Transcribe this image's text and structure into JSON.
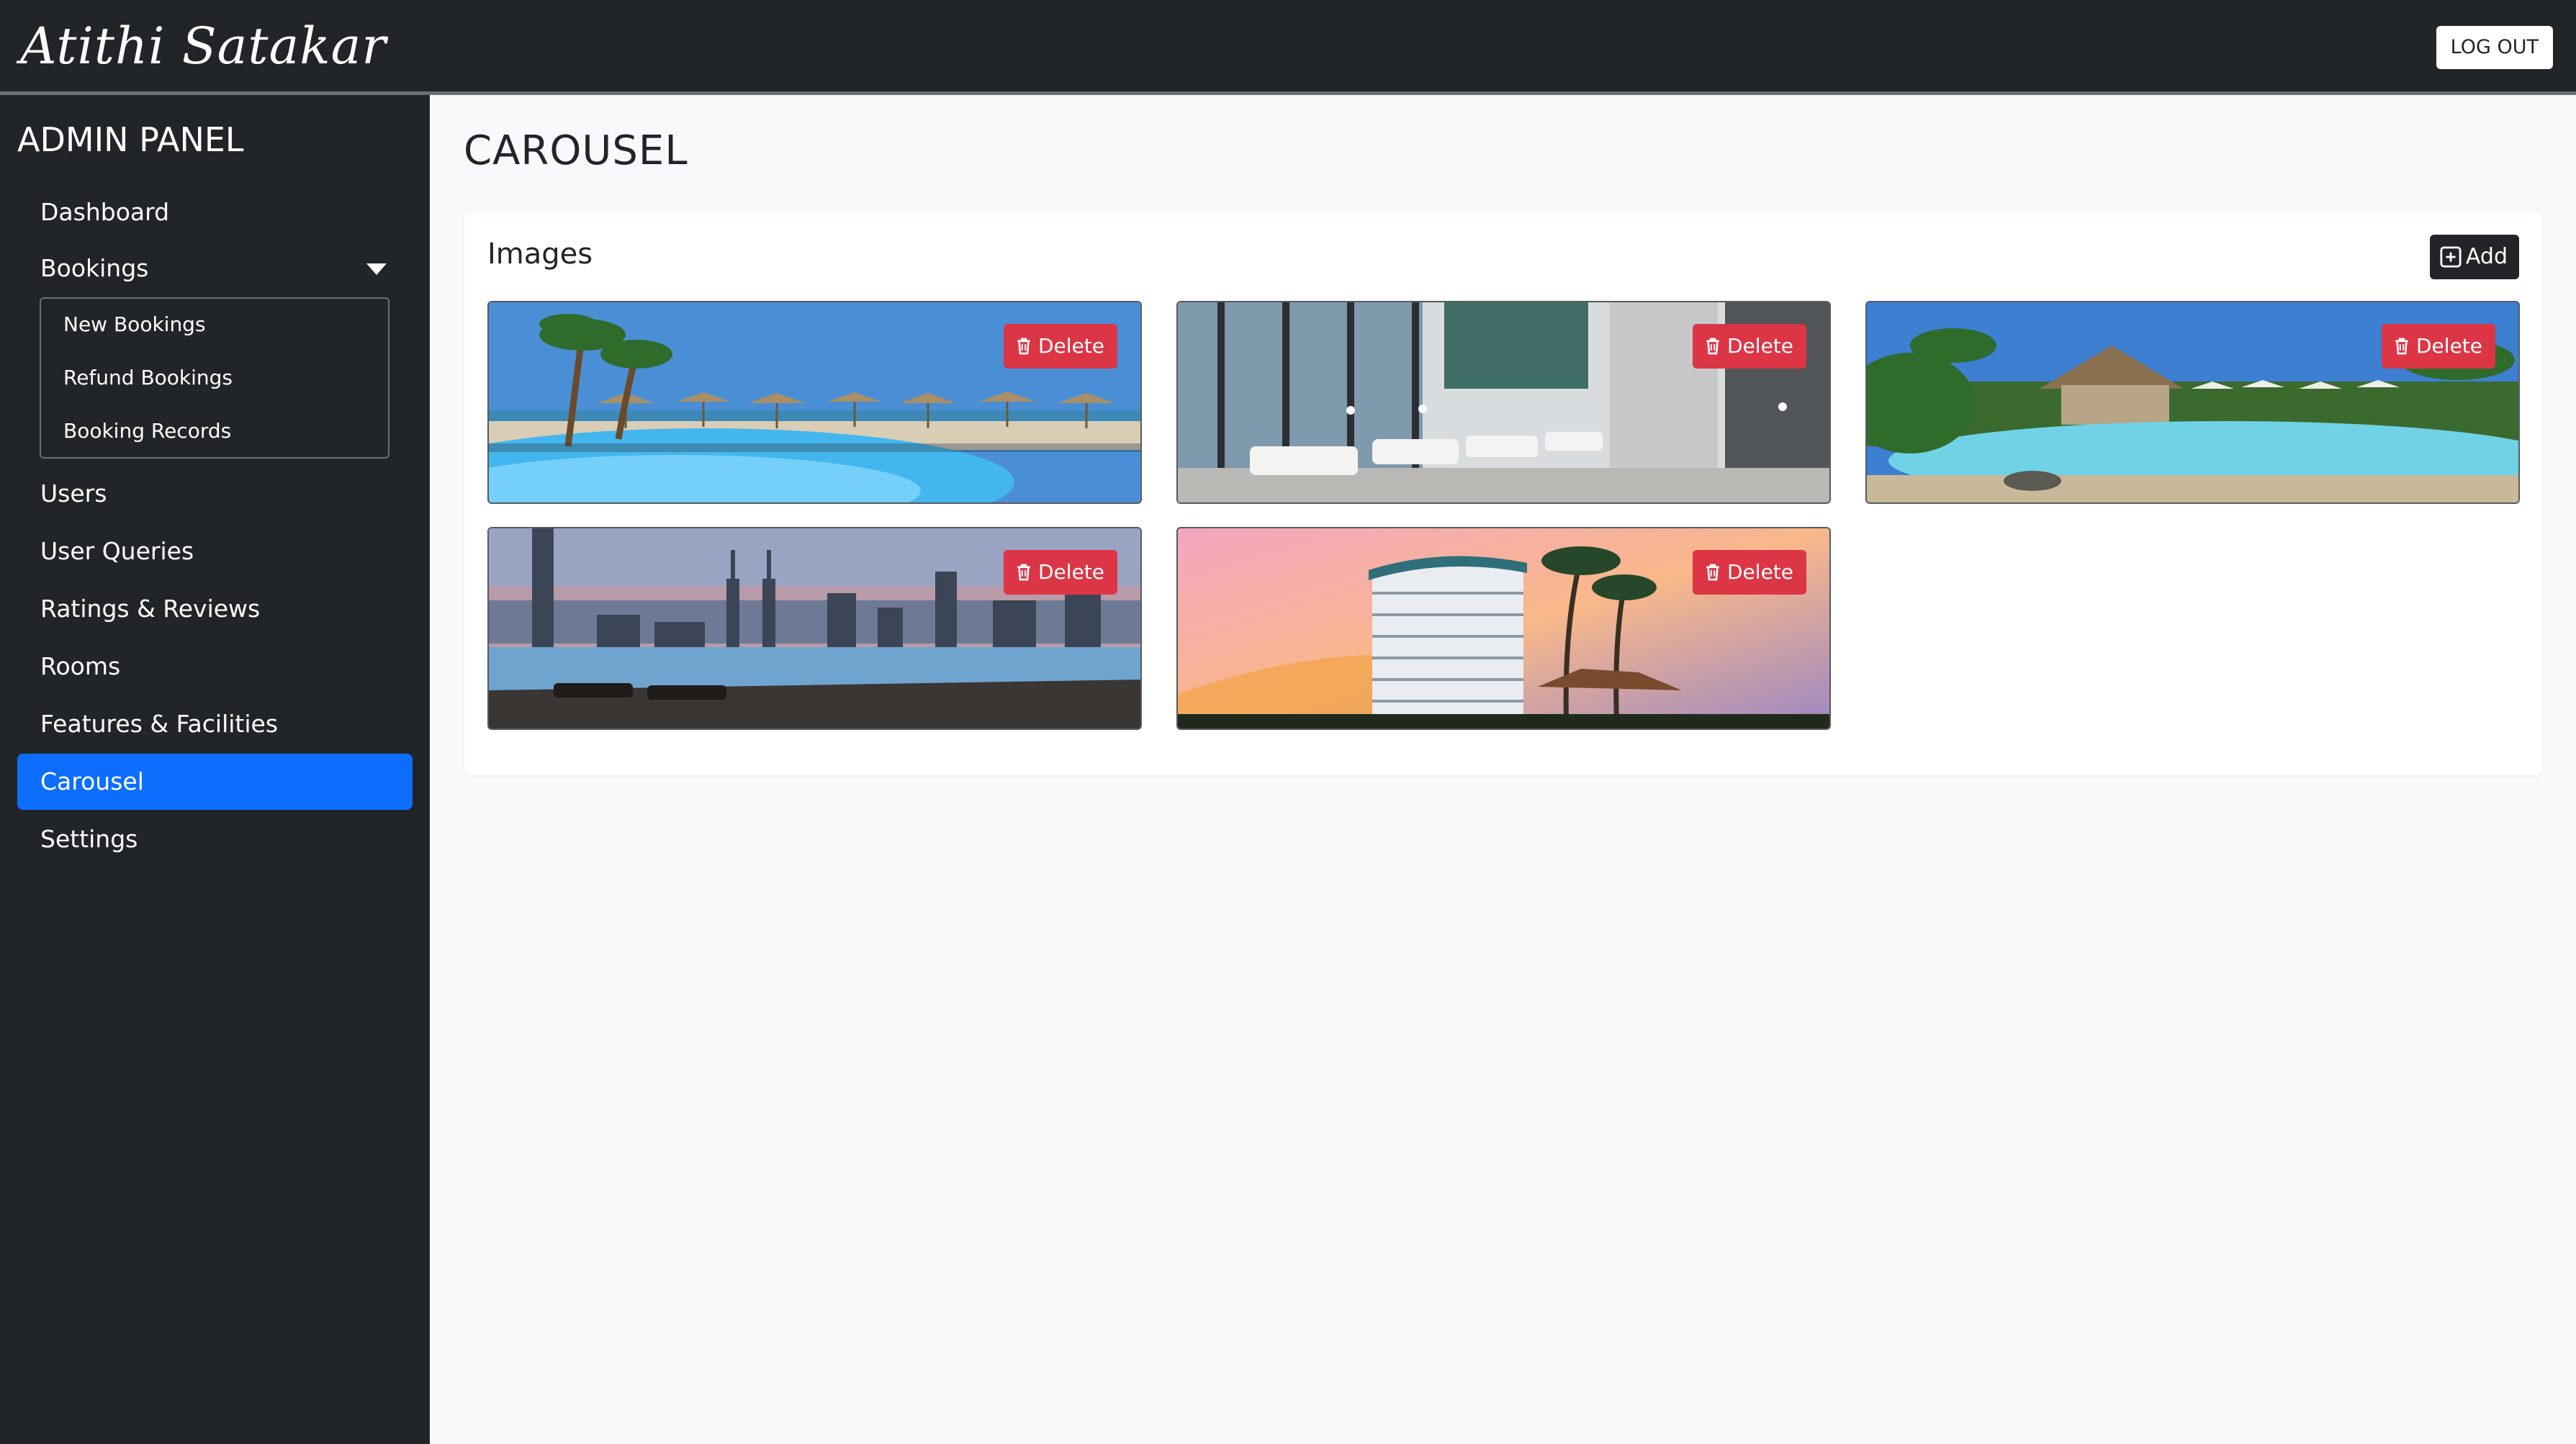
{
  "app": {
    "brand": "Atithi Satakar",
    "logout_label": "LOG OUT"
  },
  "sidebar": {
    "title": "ADMIN PANEL",
    "items": [
      {
        "label": "Dashboard"
      },
      {
        "label": "Bookings"
      },
      {
        "label": "Users"
      },
      {
        "label": "User Queries"
      },
      {
        "label": "Ratings & Reviews"
      },
      {
        "label": "Rooms"
      },
      {
        "label": "Features & Facilities"
      },
      {
        "label": "Carousel"
      },
      {
        "label": "Settings"
      }
    ],
    "bookings_subitems": [
      {
        "label": "New Bookings"
      },
      {
        "label": "Refund Bookings"
      },
      {
        "label": "Booking Records"
      }
    ],
    "active_item": "Carousel"
  },
  "main": {
    "page_title": "CAROUSEL",
    "card_title": "Images",
    "add_label": "Add",
    "delete_label": "Delete",
    "images": [
      {
        "scene": "beach-pool-palms"
      },
      {
        "scene": "hotel-lounge-interior"
      },
      {
        "scene": "tropical-pool-resort"
      },
      {
        "scene": "rooftop-infinity-pool-city"
      },
      {
        "scene": "hotel-tower-sunset"
      }
    ]
  },
  "colors": {
    "topbar": "#212529",
    "sidebar": "#212529",
    "active": "#0d6efd",
    "danger": "#dc3545",
    "background": "#f8f9fa"
  },
  "icons": {
    "add": "plus-square-icon",
    "delete": "trash-icon",
    "bookings_toggle": "caret-down-icon"
  }
}
